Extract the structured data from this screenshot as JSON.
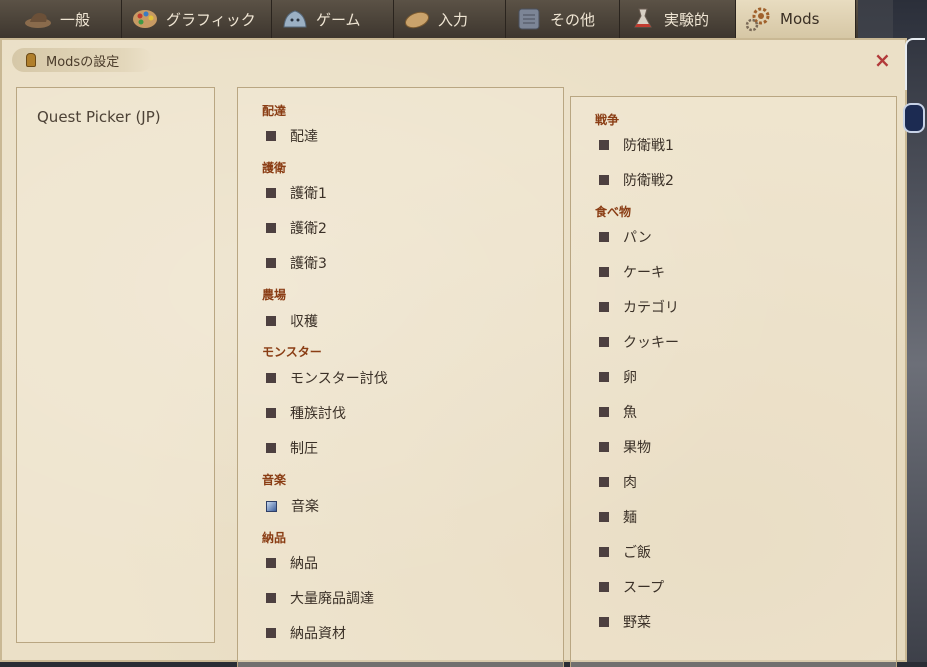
{
  "tabs": [
    {
      "label": "一般",
      "icon": "hat-icon"
    },
    {
      "label": "グラフィック",
      "icon": "palette-icon"
    },
    {
      "label": "ゲーム",
      "icon": "slime-icon"
    },
    {
      "label": "入力",
      "icon": "bread-icon"
    },
    {
      "label": "その他",
      "icon": "tablet-icon"
    },
    {
      "label": "実験的",
      "icon": "flask-icon"
    },
    {
      "label": "Mods",
      "icon": "gears-icon"
    }
  ],
  "active_tab": "Mods",
  "panel": {
    "title": "Modsの設定",
    "close": "×"
  },
  "mods": [
    "Quest Picker (JP)"
  ],
  "middle_column": [
    {
      "group": "配達",
      "items": [
        {
          "label": "配達"
        }
      ]
    },
    {
      "group": "護衛",
      "items": [
        {
          "label": "護衛1"
        },
        {
          "label": "護衛2"
        },
        {
          "label": "護衛3"
        }
      ]
    },
    {
      "group": "農場",
      "items": [
        {
          "label": "収穫"
        }
      ]
    },
    {
      "group": "モンスター",
      "items": [
        {
          "label": "モンスター討伐"
        },
        {
          "label": "種族討伐"
        },
        {
          "label": "制圧"
        }
      ]
    },
    {
      "group": "音楽",
      "items": [
        {
          "label": "音楽",
          "style": "music"
        }
      ]
    },
    {
      "group": "納品",
      "items": [
        {
          "label": "納品"
        },
        {
          "label": "大量廃品調達"
        },
        {
          "label": "納品資材"
        }
      ]
    }
  ],
  "right_column": [
    {
      "group": "戦争",
      "items": [
        {
          "label": "防衛戦1"
        },
        {
          "label": "防衛戦2"
        }
      ]
    },
    {
      "group": "食べ物",
      "items": [
        {
          "label": "パン"
        },
        {
          "label": "ケーキ"
        },
        {
          "label": "カテゴリ"
        },
        {
          "label": "クッキー"
        },
        {
          "label": "卵"
        },
        {
          "label": "魚"
        },
        {
          "label": "果物"
        },
        {
          "label": "肉"
        },
        {
          "label": "麺"
        },
        {
          "label": "ご飯"
        },
        {
          "label": "スープ"
        },
        {
          "label": "野菜"
        }
      ]
    }
  ],
  "colors": {
    "panel_bg": "#ebe0c7",
    "group_text": "#8a3d14",
    "close": "#b23a3a",
    "checkbox": "#4d4040"
  }
}
